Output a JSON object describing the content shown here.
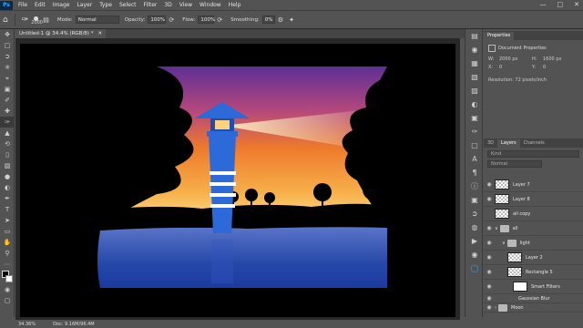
{
  "menu": {
    "logo": "Ps",
    "items": [
      "File",
      "Edit",
      "Image",
      "Layer",
      "Type",
      "Select",
      "Filter",
      "3D",
      "View",
      "Window",
      "Help"
    ]
  },
  "options": {
    "brush_size": "2000",
    "mode_label": "Mode:",
    "mode_value": "Normal",
    "opacity_label": "Opacity:",
    "opacity_value": "100%",
    "flow_label": "Flow:",
    "flow_value": "100%",
    "smoothing_label": "Smoothing:",
    "smoothing_value": "0%"
  },
  "document": {
    "tab_title": "Untitled-1 @ 34.4% (RGB/8) *",
    "zoom": "34.36%",
    "doc_size": "Doc: 9.16M/96.4M"
  },
  "properties": {
    "tabs": [
      "Properties"
    ],
    "title": "Document Properties",
    "w_label": "W:",
    "w_value": "2000 px",
    "h_label": "H:",
    "h_value": "1600 px",
    "x_label": "X:",
    "x_value": "0",
    "y_label": "Y:",
    "y_value": "0",
    "resolution": "Resolution: 72 pixels/inch"
  },
  "layers_panel": {
    "tabs": [
      "3D",
      "Layers",
      "Channels"
    ],
    "search_placeholder": "Kind",
    "blend_mode": "Normal",
    "layers": [
      {
        "name": "Layer 7",
        "kind": "pixel",
        "indent": 0
      },
      {
        "name": "Layer 8",
        "kind": "pixel",
        "indent": 0
      },
      {
        "name": "all copy",
        "kind": "pixel",
        "indent": 0
      },
      {
        "name": "all",
        "kind": "group",
        "indent": 0
      },
      {
        "name": "light",
        "kind": "group",
        "indent": 1
      },
      {
        "name": "Layer 2",
        "kind": "pixel",
        "indent": 2
      },
      {
        "name": "Rectangle 5",
        "kind": "pixel",
        "indent": 2
      },
      {
        "name": "Smart Filters",
        "kind": "filter",
        "indent": 3
      },
      {
        "name": "Gaussian Blur",
        "kind": "filter",
        "indent": 3
      },
      {
        "name": "Moon",
        "kind": "group",
        "indent": 0
      }
    ]
  }
}
